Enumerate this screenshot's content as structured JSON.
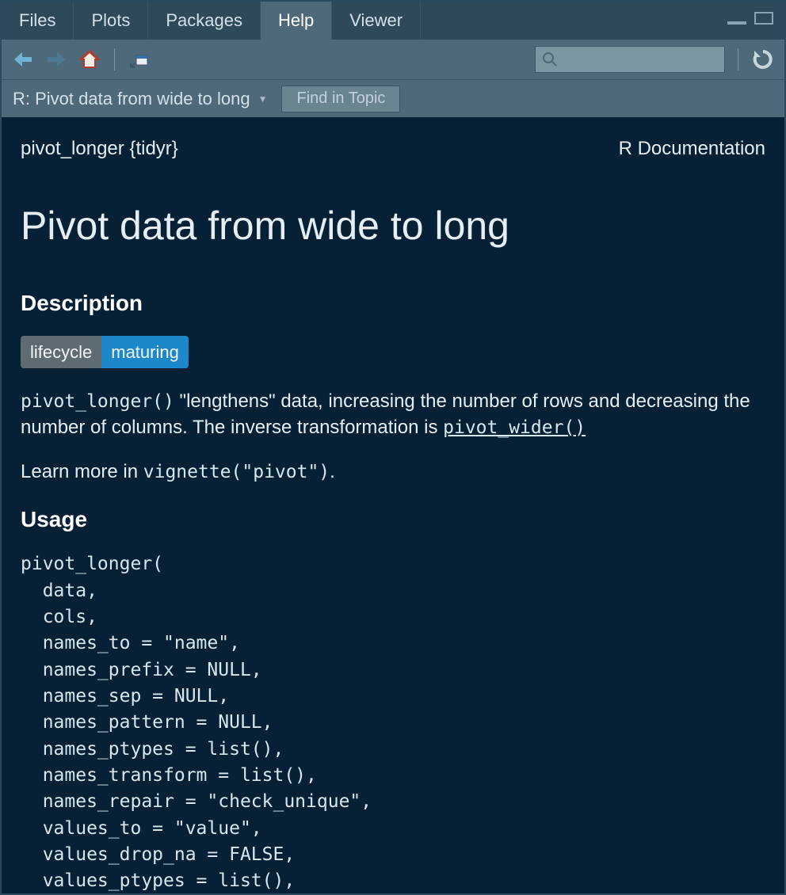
{
  "tabs": {
    "files": "Files",
    "plots": "Plots",
    "packages": "Packages",
    "help": "Help",
    "viewer": "Viewer"
  },
  "breadcrumb": {
    "label": "R: Pivot data from wide to long"
  },
  "findtopic": {
    "placeholder": "Find in Topic"
  },
  "doc": {
    "topic": "pivot_longer {tidyr}",
    "source": "R Documentation",
    "title": "Pivot data from wide to long",
    "sect_description": "Description",
    "badge_left": "lifecycle",
    "badge_right": "maturing",
    "code_pivot_longer": "pivot_longer()",
    "desc_p1_rest": " \"lengthens\" data, increasing the number of rows and decreasing the number of columns. The inverse transformation is ",
    "link_pivot_wider": "pivot_wider()",
    "desc_p2_lead": "Learn more in ",
    "code_vignette": "vignette(\"pivot\")",
    "desc_p2_tail": ".",
    "sect_usage": "Usage",
    "usage_code": "pivot_longer(\n  data,\n  cols,\n  names_to = \"name\",\n  names_prefix = NULL,\n  names_sep = NULL,\n  names_pattern = NULL,\n  names_ptypes = list(),\n  names_transform = list(),\n  names_repair = \"check_unique\",\n  values_to = \"value\",\n  values_drop_na = FALSE,\n  values_ptypes = list(),"
  }
}
